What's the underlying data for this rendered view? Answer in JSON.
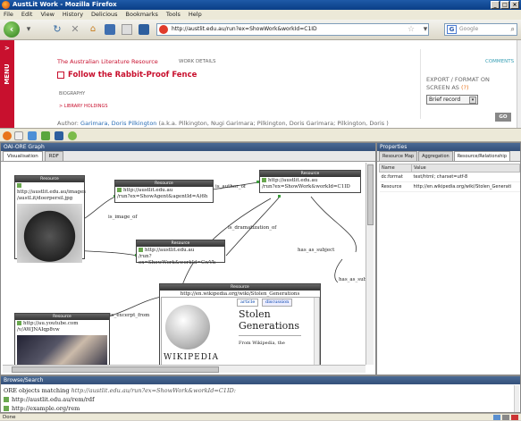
{
  "window": {
    "title": "AustLit Work - Mozilla Firefox"
  },
  "menu": [
    "File",
    "Edit",
    "View",
    "History",
    "Delicious",
    "Bookmarks",
    "Tools",
    "Help"
  ],
  "nav": {
    "url": "http://austlit.edu.au/run?ex=ShowWork&workId=C1ID",
    "search_placeholder": "Google"
  },
  "page": {
    "menu_tab": "MENU",
    "site_name": "The Australian Literature Resource",
    "work_details": "WORK DETAILS",
    "comments": "COMMENTS",
    "work_title": "Follow the Rabbit-Proof Fence",
    "biography": "BIOGRAPHY",
    "library_holdings": "> LIBRARY HOLDINGS",
    "author_label": "Author:",
    "author_links": "Garimara, Doris Pilkington",
    "author_aka": "(a.k.a. Pilkington, Nugi Garimara; Pilkington, Doris Garimara; Pilkington, Doris )",
    "export_title": "EXPORT / FORMAT ON SCREEN AS",
    "export_help": "(?)",
    "export_value": "Brief record",
    "go_button": "GO"
  },
  "graph": {
    "panel_title": "OAI-ORE Graph",
    "tabs": [
      "Visualisation",
      "RDF"
    ],
    "node_header": "Resource",
    "nodes": {
      "image_line1": "http://austlit.edu.au/images",
      "image_line2": "/austLit/doorpersil.jpg",
      "agent_line1": "http://austlit.edu.au",
      "agent_line2": "/run?ex=ShowAgent&agentId=A)6h",
      "work_line1": "http://austlit.edu.au",
      "work_line2": "/run?ex=ShowWork&workId=C1ID",
      "drama_line1": "http://austlit.edu.au",
      "drama_line2": "/run?ex=ShowWork&workId=CwVk",
      "youtube_line1": "http://au.youtube.com",
      "youtube_line2": "/v/AWJNAIqp8vw",
      "wiki_url": "http://en.wikipedia.org/wiki/Stolen_Generations"
    },
    "edges": {
      "image_of": "is_image_of",
      "author_of": "is_author_of",
      "dramatization_of": "is_dramatization_of",
      "has_as_subject_1": "has_as_subject",
      "has_as_subject_2": "has_as_sub",
      "excerpt_from": "is_excerpt_from"
    },
    "wiki_preview": {
      "tab_article": "article",
      "tab_discussion": "discussion",
      "heading": "Stolen Generations",
      "snippet": "From Wikipedia, the",
      "logo_text": "WIKIPEDIA"
    }
  },
  "properties": {
    "panel_title": "Properties",
    "tabs": [
      "Resource Map",
      "Aggregation",
      "Resource/Relationship"
    ],
    "columns": [
      "Name",
      "Value"
    ],
    "rows": [
      {
        "name": "dc:format",
        "value": "text/html; charset=utf-8"
      },
      {
        "name": "Resource",
        "value": "http://en.wikipedia.org/wiki/Stolen_Generati"
      }
    ]
  },
  "browse": {
    "panel_title": "Browse/Search",
    "matching_prefix": "ORE objects matching",
    "matching_query": "http://austlit.edu.au/run?ex=ShowWork&workId=C1ID:",
    "items": [
      "http://austlit.edu.au/rem/rdf",
      "http://example.org/rem"
    ]
  },
  "status": {
    "text": "Done"
  }
}
